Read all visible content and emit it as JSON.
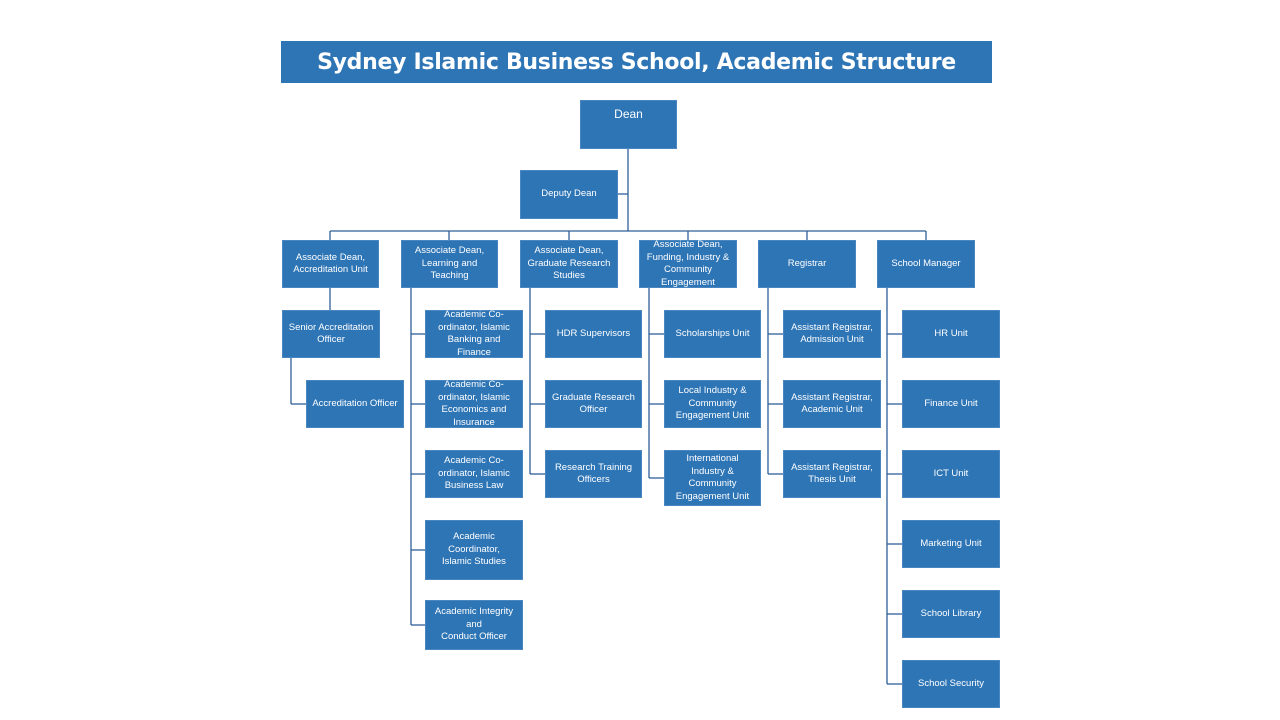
{
  "title": "Sydney Islamic Business School, Academic Structure",
  "colors": {
    "box": "#2e75b6",
    "line": "#2e5f99",
    "text": "#ffffff"
  },
  "nodes": {
    "dean": "Dean",
    "deputy_dean": "Deputy Dean",
    "assoc_accreditation": "Associate Dean,\nAccreditation  Unit",
    "assoc_learning": "Associate Dean,\nLearning and\nTeaching",
    "assoc_graduate": "Associate Dean,\nGraduate Research\nStudies",
    "assoc_funding": "Associate Dean,\nFunding, Industry &\nCommunity\nEngagement",
    "registrar": "Registrar",
    "school_manager": "School Manager",
    "senior_accreditation": "Senior Accreditation\nOfficer",
    "accreditation_officer": "Accreditation  Officer",
    "coord_banking": "Academic Co-\nordinator,  Islamic\nBanking and\nFinance",
    "coord_economics": "Academic Co-\nordinator,  Islamic\nEconomics and\nInsurance",
    "coord_law": "Academic Co-\nordinator,  Islamic\nBusiness Law",
    "coord_studies": "Academic\nCoordinator,\nIslamic Studies",
    "integrity_officer": "Academic  Integrity\nand\nConduct Officer",
    "hdr_supervisors": "HDR Supervisors",
    "graduate_research_officer": "Graduate Research\nOfficer",
    "research_training_officers": "Research Training\nOfficers",
    "scholarships_unit": "Scholarships  Unit",
    "local_industry": "Local Industry &\nCommunity\nEngagement Unit",
    "international_industry": "International\nIndustry &\nCommunity\nEngagement Unit",
    "asst_registrar_admission": "Assistant Registrar,\nAdmission Unit",
    "asst_registrar_academic": "Assistant Registrar,\nAcademic Unit",
    "asst_registrar_thesis": "Assistant Registrar,\nThesis Unit",
    "hr_unit": "HR Unit",
    "finance_unit": "Finance Unit",
    "ict_unit": "ICT Unit",
    "marketing_unit": "Marketing Unit",
    "school_library": "School Library",
    "school_security": "School Security"
  }
}
